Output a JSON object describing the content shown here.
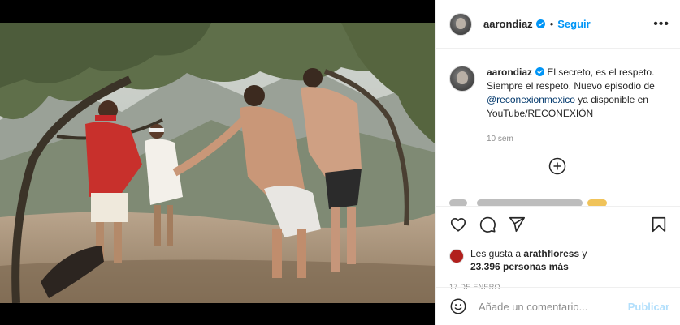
{
  "post": {
    "username": "aarondiaz",
    "separator": "•",
    "follow_label": "Seguir",
    "more_label": "•••",
    "verified_icon": "verified-badge-icon",
    "caption": {
      "username": "aarondiaz",
      "text_before": " El secreto, es el respeto. Siempre el respeto. Nuevo episodio de ",
      "mention": "@reconexionmexico",
      "text_after": " ya disponible en YouTube/RECONEXIÓN",
      "time": "10 sem"
    },
    "load_more_icon": "add-circle-icon",
    "actions": {
      "like_icon": "heart-icon",
      "comment_icon": "comment-bubble-icon",
      "share_icon": "paper-plane-icon",
      "save_icon": "bookmark-icon"
    },
    "likes": {
      "prefix": "Les gusta a ",
      "user": "arathfloress",
      "connector": " y",
      "count": "23.396 personas más"
    },
    "date": "17 DE ENERO",
    "comment_box": {
      "placeholder": "Añade un comentario...",
      "publish_label": "Publicar",
      "emoji_icon": "smiley-icon"
    }
  },
  "colors": {
    "accent": "#0095f6",
    "mention": "#00376b",
    "muted": "#8e8e8e",
    "publish_disabled": "#b2dffc",
    "border": "#efefef"
  }
}
